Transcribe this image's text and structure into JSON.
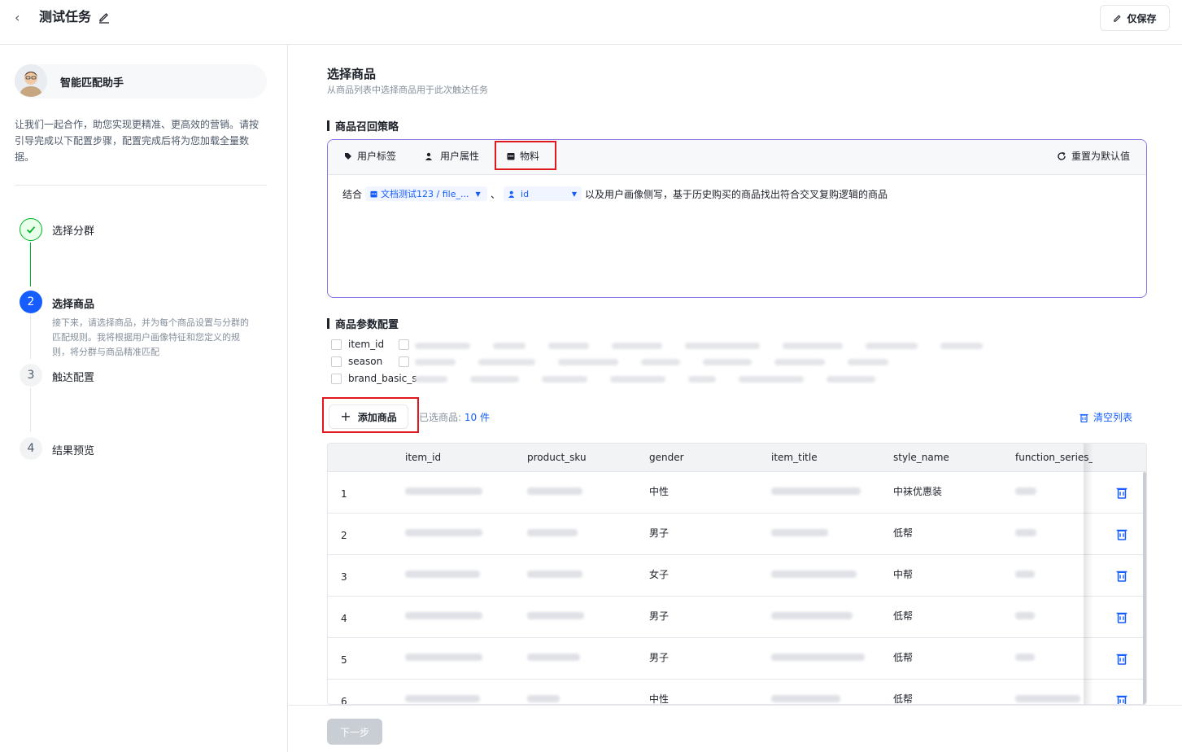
{
  "header": {
    "title": "测试任务",
    "save_label": "仅保存"
  },
  "sidebar": {
    "assistant_name": "智能匹配助手",
    "intro": "让我们一起合作，助您实现更精准、更高效的营销。请按引导完成以下配置步骤，配置完成后将为您加载全量数据。",
    "steps": [
      {
        "num": "",
        "label": "选择分群",
        "status": "done"
      },
      {
        "num": "2",
        "label": "选择商品",
        "status": "active",
        "desc": "接下来，请选择商品，并为每个商品设置与分群的匹配规则。我将根据用户画像特征和您定义的规则，将分群与商品精准匹配"
      },
      {
        "num": "3",
        "label": "触达配置",
        "status": "todo"
      },
      {
        "num": "4",
        "label": "结果预览",
        "status": "todo"
      }
    ]
  },
  "main": {
    "title": "选择商品",
    "subtitle": "从商品列表中选择商品用于此次触达任务",
    "strategy": {
      "heading": "商品召回策略",
      "tabs": [
        "用户标签",
        "用户属性",
        "物料"
      ],
      "reset_label": "重置为默认值",
      "text_prefix": "结合",
      "chip1": "文档测试123 / file_...",
      "separator": "、",
      "chip2": "id",
      "text_suffix": "以及用户画像侧写，基于历史购买的商品找出符合交叉复购逻辑的商品"
    },
    "params": {
      "heading": "商品参数配置",
      "items": [
        "item_id",
        "season",
        "brand_basic_s"
      ]
    },
    "add_label": "添加商品",
    "selected_prefix": "已选商品:",
    "selected_count": "10 件",
    "clear_label": "清空列表",
    "table": {
      "columns": [
        "item_id",
        "product_sku",
        "gender",
        "item_title",
        "style_name",
        "function_series_n"
      ],
      "rows": [
        {
          "idx": "1",
          "gender": "中性",
          "style": "中袜优惠装"
        },
        {
          "idx": "2",
          "gender": "男子",
          "style": "低帮"
        },
        {
          "idx": "3",
          "gender": "女子",
          "style": "中帮"
        },
        {
          "idx": "4",
          "gender": "男子",
          "style": "低帮"
        },
        {
          "idx": "5",
          "gender": "男子",
          "style": "低帮"
        },
        {
          "idx": "6",
          "gender": "中性",
          "style": "低帮"
        }
      ]
    }
  },
  "footer": {
    "next_label": "下一步"
  }
}
